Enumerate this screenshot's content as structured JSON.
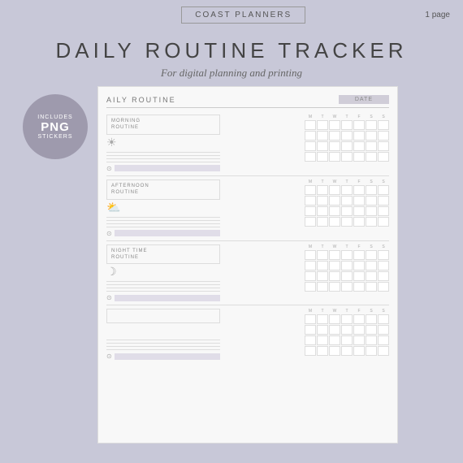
{
  "topBar": {
    "brand": "COAST PLANNERS",
    "pages": "1 page"
  },
  "header": {
    "mainTitle": "DAILY ROUTINE TRACKER",
    "subTitle": "For digital planning and printing"
  },
  "sticker": {
    "includes": "INCLUDES",
    "png": "PNG",
    "stickers": "STICKERS"
  },
  "planner": {
    "title": "AILY ROUTINE",
    "dateLabel": "DATE",
    "sections": [
      {
        "label": "MORNING\nROUTINE",
        "icon": "☀",
        "lines": 4,
        "gridRows": 4
      },
      {
        "label": "AFTERNOON\nROUTINE",
        "icon": "⛅",
        "lines": 4,
        "gridRows": 4
      },
      {
        "label": "NIGHT TIME\nROUTINE",
        "icon": "☾",
        "lines": 4,
        "gridRows": 4
      },
      {
        "label": "",
        "icon": "",
        "lines": 4,
        "gridRows": 4
      }
    ],
    "days": [
      "M",
      "T",
      "W",
      "T",
      "F",
      "S",
      "S"
    ]
  }
}
